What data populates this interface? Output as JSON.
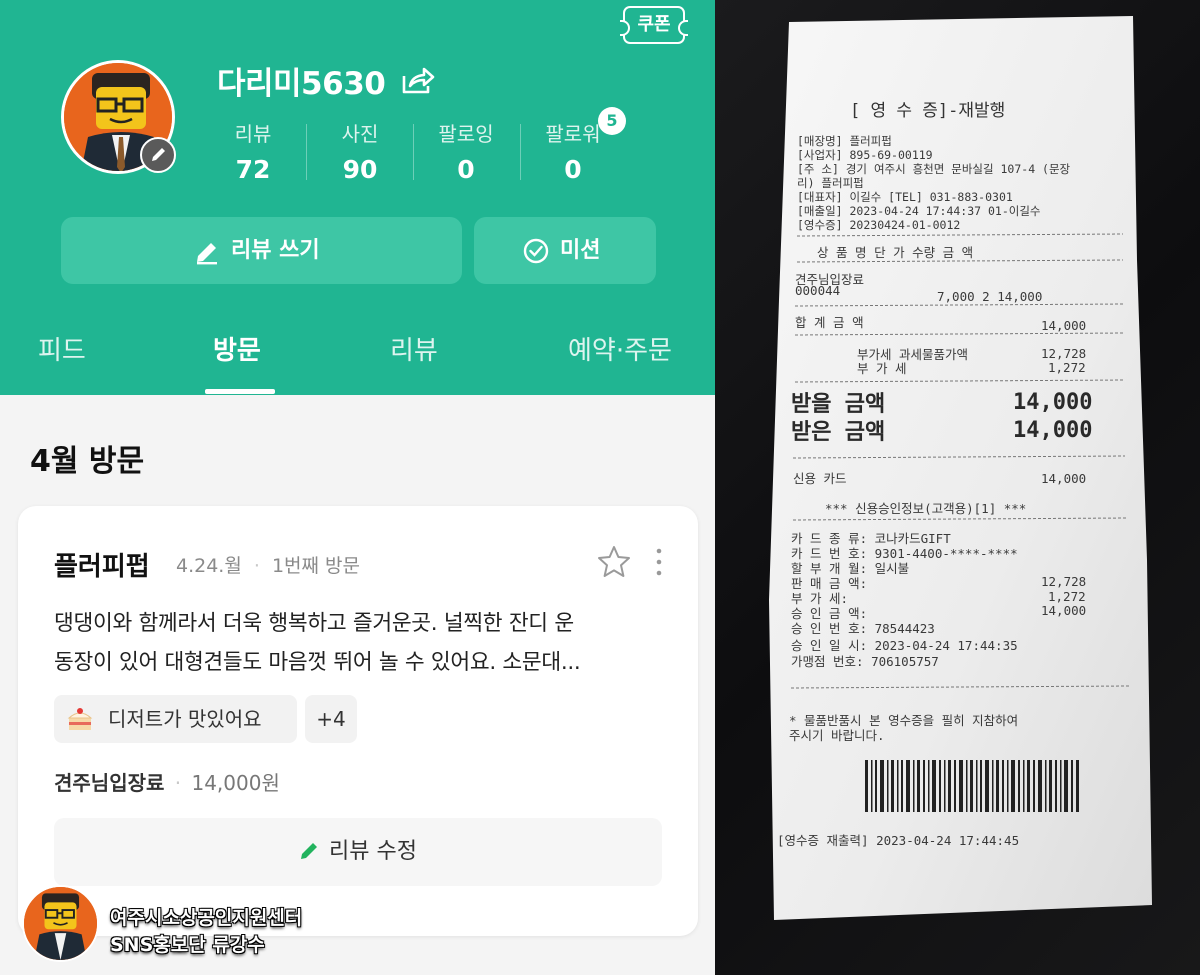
{
  "profile": {
    "coupon_label": "쿠폰",
    "nickname": "다리미5630",
    "stats": [
      {
        "label": "리뷰",
        "value": "72"
      },
      {
        "label": "사진",
        "value": "90"
      },
      {
        "label": "팔로잉",
        "value": "0"
      },
      {
        "label": "팔로워",
        "value": "0"
      }
    ],
    "follower_badge": "5"
  },
  "actions": {
    "write_review": "리뷰 쓰기",
    "mission": "미션"
  },
  "tabs": [
    "피드",
    "방문",
    "리뷰",
    "예약·주문"
  ],
  "active_tab": "방문",
  "section_title": "4월 방문",
  "visit_card": {
    "place": "플러피펍",
    "date": "4.24.월",
    "visit_count": "1번째 방문",
    "review_line1": "댕댕이와 함께라서 더욱 행복하고 즐거운곳. 널찍한 잔디 운",
    "review_line2": "동장이 있어 대형견들도 마음껏 뛰어 놀 수 있어요. 소문대...",
    "tag_icon": "cake-icon",
    "tag": "디저트가 맛있어요",
    "tag_more": "+4",
    "receipt_item": "견주님입장료",
    "receipt_amount": "14,000원",
    "edit_button": "리뷰 수정"
  },
  "footer": {
    "line1": "여주시소상공인지원센터",
    "line2": "SNS홍보단 류강수"
  },
  "receipt": {
    "title": "[ 영 수 증]-재발행",
    "store_name": "[매장명] 플러피펍",
    "biz_no": "[사업자] 895-69-00119",
    "address1": "[주   소] 경기 여주시 흥천면 문바실길 107-4 (문장",
    "address2": "리) 플러피펍",
    "ceo": "[대표자] 이길수        [TEL] 031-883-0301",
    "sale_date": "[매출일] 2023-04-24 17:44:37      01-이길수",
    "receipt_no": "[영수증] 20230424-01-0012",
    "col_headers": "상  품  명        단 가  수량    금  액",
    "item_name": "견주님입장료",
    "item_code": "000044",
    "item_values": "7,000    2      14,000",
    "total_label": "합  계  금  액",
    "total_value": "14,000",
    "taxable_label": "부가세 과세물품가액",
    "taxable_value": "12,728",
    "vat_label": "부         가        세",
    "vat_value": "1,272",
    "receivable_label": "받을 금액",
    "receivable_value": "14,000",
    "received_label": "받은 금액",
    "received_value": "14,000",
    "card_label": "신용  카드",
    "card_value": "14,000",
    "approval_header": "*** 신용승인정보(고객용)[1] ***",
    "card_type": "카 드 종 류:              코나카드GIFT",
    "card_no": "카 드 번 호: 9301-4400-****-****",
    "installment": "할 부 개 월: 일시불",
    "sale_amount_label": "판 매 금 액:",
    "sale_amount": "12,728",
    "vat2_label": "부   가   세:",
    "vat2": "1,272",
    "approved_amount_label": "승 인 금 액:",
    "approved_amount": "14,000",
    "approval_no": "승 인 번 호: 78544423",
    "approval_time": "승 인 일 시: 2023-04-24 17:44:35",
    "merchant_no": "가맹점 번호: 706105757",
    "notice1": "* 물품반품시 본 영수증을 필히 지참하여",
    "notice2": "  주시기 바랍니다.",
    "reprint": "[영수증 재출력] 2023-04-24 17:44:45"
  },
  "colors": {
    "brand_green": "#20b592",
    "button_green": "#3ec6a5",
    "avatar_orange": "#e8651d"
  }
}
